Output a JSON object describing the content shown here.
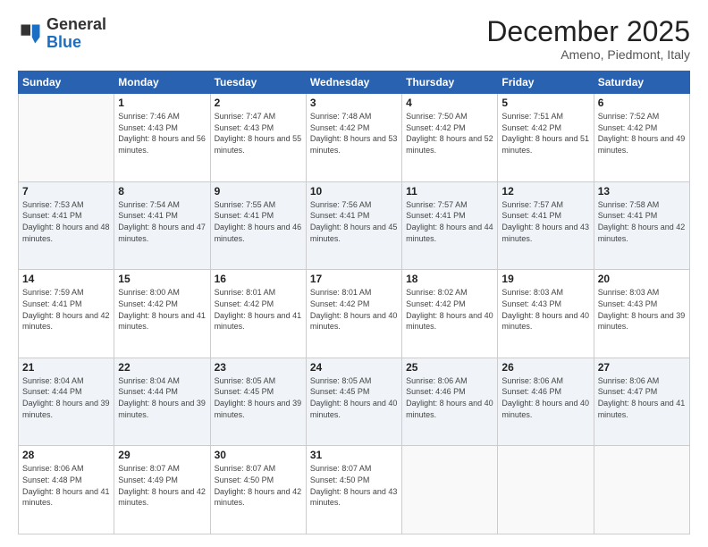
{
  "header": {
    "logo_general": "General",
    "logo_blue": "Blue",
    "month_title": "December 2025",
    "subtitle": "Ameno, Piedmont, Italy"
  },
  "days_of_week": [
    "Sunday",
    "Monday",
    "Tuesday",
    "Wednesday",
    "Thursday",
    "Friday",
    "Saturday"
  ],
  "weeks": [
    [
      {
        "day": "",
        "sunrise": "",
        "sunset": "",
        "daylight": ""
      },
      {
        "day": "1",
        "sunrise": "Sunrise: 7:46 AM",
        "sunset": "Sunset: 4:43 PM",
        "daylight": "Daylight: 8 hours and 56 minutes."
      },
      {
        "day": "2",
        "sunrise": "Sunrise: 7:47 AM",
        "sunset": "Sunset: 4:43 PM",
        "daylight": "Daylight: 8 hours and 55 minutes."
      },
      {
        "day": "3",
        "sunrise": "Sunrise: 7:48 AM",
        "sunset": "Sunset: 4:42 PM",
        "daylight": "Daylight: 8 hours and 53 minutes."
      },
      {
        "day": "4",
        "sunrise": "Sunrise: 7:50 AM",
        "sunset": "Sunset: 4:42 PM",
        "daylight": "Daylight: 8 hours and 52 minutes."
      },
      {
        "day": "5",
        "sunrise": "Sunrise: 7:51 AM",
        "sunset": "Sunset: 4:42 PM",
        "daylight": "Daylight: 8 hours and 51 minutes."
      },
      {
        "day": "6",
        "sunrise": "Sunrise: 7:52 AM",
        "sunset": "Sunset: 4:42 PM",
        "daylight": "Daylight: 8 hours and 49 minutes."
      }
    ],
    [
      {
        "day": "7",
        "sunrise": "Sunrise: 7:53 AM",
        "sunset": "Sunset: 4:41 PM",
        "daylight": "Daylight: 8 hours and 48 minutes."
      },
      {
        "day": "8",
        "sunrise": "Sunrise: 7:54 AM",
        "sunset": "Sunset: 4:41 PM",
        "daylight": "Daylight: 8 hours and 47 minutes."
      },
      {
        "day": "9",
        "sunrise": "Sunrise: 7:55 AM",
        "sunset": "Sunset: 4:41 PM",
        "daylight": "Daylight: 8 hours and 46 minutes."
      },
      {
        "day": "10",
        "sunrise": "Sunrise: 7:56 AM",
        "sunset": "Sunset: 4:41 PM",
        "daylight": "Daylight: 8 hours and 45 minutes."
      },
      {
        "day": "11",
        "sunrise": "Sunrise: 7:57 AM",
        "sunset": "Sunset: 4:41 PM",
        "daylight": "Daylight: 8 hours and 44 minutes."
      },
      {
        "day": "12",
        "sunrise": "Sunrise: 7:57 AM",
        "sunset": "Sunset: 4:41 PM",
        "daylight": "Daylight: 8 hours and 43 minutes."
      },
      {
        "day": "13",
        "sunrise": "Sunrise: 7:58 AM",
        "sunset": "Sunset: 4:41 PM",
        "daylight": "Daylight: 8 hours and 42 minutes."
      }
    ],
    [
      {
        "day": "14",
        "sunrise": "Sunrise: 7:59 AM",
        "sunset": "Sunset: 4:41 PM",
        "daylight": "Daylight: 8 hours and 42 minutes."
      },
      {
        "day": "15",
        "sunrise": "Sunrise: 8:00 AM",
        "sunset": "Sunset: 4:42 PM",
        "daylight": "Daylight: 8 hours and 41 minutes."
      },
      {
        "day": "16",
        "sunrise": "Sunrise: 8:01 AM",
        "sunset": "Sunset: 4:42 PM",
        "daylight": "Daylight: 8 hours and 41 minutes."
      },
      {
        "day": "17",
        "sunrise": "Sunrise: 8:01 AM",
        "sunset": "Sunset: 4:42 PM",
        "daylight": "Daylight: 8 hours and 40 minutes."
      },
      {
        "day": "18",
        "sunrise": "Sunrise: 8:02 AM",
        "sunset": "Sunset: 4:42 PM",
        "daylight": "Daylight: 8 hours and 40 minutes."
      },
      {
        "day": "19",
        "sunrise": "Sunrise: 8:03 AM",
        "sunset": "Sunset: 4:43 PM",
        "daylight": "Daylight: 8 hours and 40 minutes."
      },
      {
        "day": "20",
        "sunrise": "Sunrise: 8:03 AM",
        "sunset": "Sunset: 4:43 PM",
        "daylight": "Daylight: 8 hours and 39 minutes."
      }
    ],
    [
      {
        "day": "21",
        "sunrise": "Sunrise: 8:04 AM",
        "sunset": "Sunset: 4:44 PM",
        "daylight": "Daylight: 8 hours and 39 minutes."
      },
      {
        "day": "22",
        "sunrise": "Sunrise: 8:04 AM",
        "sunset": "Sunset: 4:44 PM",
        "daylight": "Daylight: 8 hours and 39 minutes."
      },
      {
        "day": "23",
        "sunrise": "Sunrise: 8:05 AM",
        "sunset": "Sunset: 4:45 PM",
        "daylight": "Daylight: 8 hours and 39 minutes."
      },
      {
        "day": "24",
        "sunrise": "Sunrise: 8:05 AM",
        "sunset": "Sunset: 4:45 PM",
        "daylight": "Daylight: 8 hours and 40 minutes."
      },
      {
        "day": "25",
        "sunrise": "Sunrise: 8:06 AM",
        "sunset": "Sunset: 4:46 PM",
        "daylight": "Daylight: 8 hours and 40 minutes."
      },
      {
        "day": "26",
        "sunrise": "Sunrise: 8:06 AM",
        "sunset": "Sunset: 4:46 PM",
        "daylight": "Daylight: 8 hours and 40 minutes."
      },
      {
        "day": "27",
        "sunrise": "Sunrise: 8:06 AM",
        "sunset": "Sunset: 4:47 PM",
        "daylight": "Daylight: 8 hours and 41 minutes."
      }
    ],
    [
      {
        "day": "28",
        "sunrise": "Sunrise: 8:06 AM",
        "sunset": "Sunset: 4:48 PM",
        "daylight": "Daylight: 8 hours and 41 minutes."
      },
      {
        "day": "29",
        "sunrise": "Sunrise: 8:07 AM",
        "sunset": "Sunset: 4:49 PM",
        "daylight": "Daylight: 8 hours and 42 minutes."
      },
      {
        "day": "30",
        "sunrise": "Sunrise: 8:07 AM",
        "sunset": "Sunset: 4:50 PM",
        "daylight": "Daylight: 8 hours and 42 minutes."
      },
      {
        "day": "31",
        "sunrise": "Sunrise: 8:07 AM",
        "sunset": "Sunset: 4:50 PM",
        "daylight": "Daylight: 8 hours and 43 minutes."
      },
      {
        "day": "",
        "sunrise": "",
        "sunset": "",
        "daylight": ""
      },
      {
        "day": "",
        "sunrise": "",
        "sunset": "",
        "daylight": ""
      },
      {
        "day": "",
        "sunrise": "",
        "sunset": "",
        "daylight": ""
      }
    ]
  ]
}
